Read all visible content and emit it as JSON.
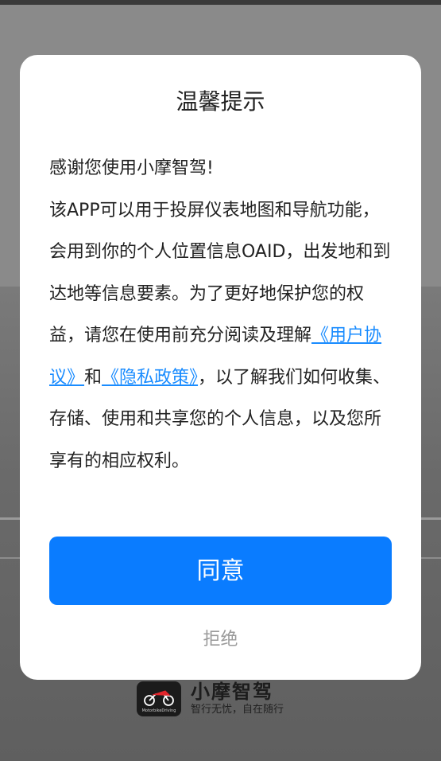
{
  "dialog": {
    "title": "温馨提示",
    "greeting": "感谢您使用小摩智驾!",
    "para_1": " 该APP可以用于投屏仪表地图和导航功能，会用到你的个人位置信息OAID，出发地和到达地等信息要素。为了更好地保护您的权益，请您在使用前充分阅读及理解",
    "link_agreement": "《用户协议》",
    "and_text": "和",
    "link_privacy": "《隐私政策》",
    "para_2": "，以了解我们如何收集、存储、使用和共享您的个人信息，以及您所享有的相应权利。",
    "agree_label": "同意",
    "reject_label": "拒绝"
  },
  "brand": {
    "name": "小摩智驾",
    "slogan": "智行无忧，自在随行",
    "logo_caption": "MotorbikeDriving"
  },
  "colors": {
    "accent": "#0a7cff",
    "link": "#1a8cff",
    "reject": "#9a9a9a"
  },
  "icons": {
    "brand_logo": "motorcycle-icon"
  }
}
